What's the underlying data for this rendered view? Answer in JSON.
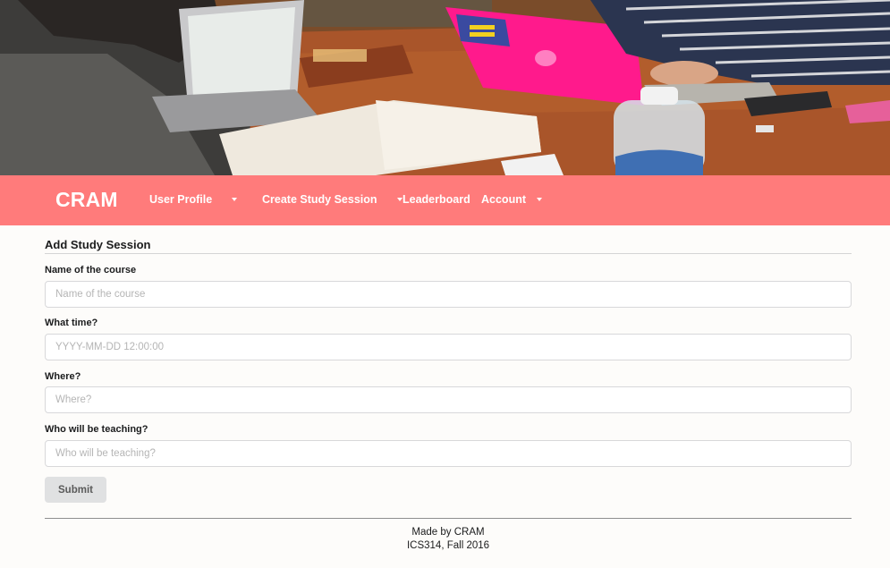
{
  "navbar": {
    "brand": "CRAM",
    "items": [
      {
        "label": "User Profile",
        "has_dropdown": true
      },
      {
        "label": "Create Study Session",
        "has_dropdown": true
      },
      {
        "label": "Leaderboard",
        "has_dropdown": false
      },
      {
        "label": "Account",
        "has_dropdown": true
      }
    ],
    "background_color": "#ff7b7b"
  },
  "form": {
    "title": "Add Study Session",
    "fields": [
      {
        "label": "Name of the course",
        "placeholder": "Name of the course",
        "value": ""
      },
      {
        "label": "What time?",
        "placeholder": "YYYY-MM-DD 12:00:00",
        "value": ""
      },
      {
        "label": "Where?",
        "placeholder": "Where?",
        "value": ""
      },
      {
        "label": "Who will be teaching?",
        "placeholder": "Who will be teaching?",
        "value": ""
      }
    ],
    "submit_label": "Submit"
  },
  "footer": {
    "line1": "Made by CRAM",
    "line2": "ICS314, Fall 2016"
  }
}
